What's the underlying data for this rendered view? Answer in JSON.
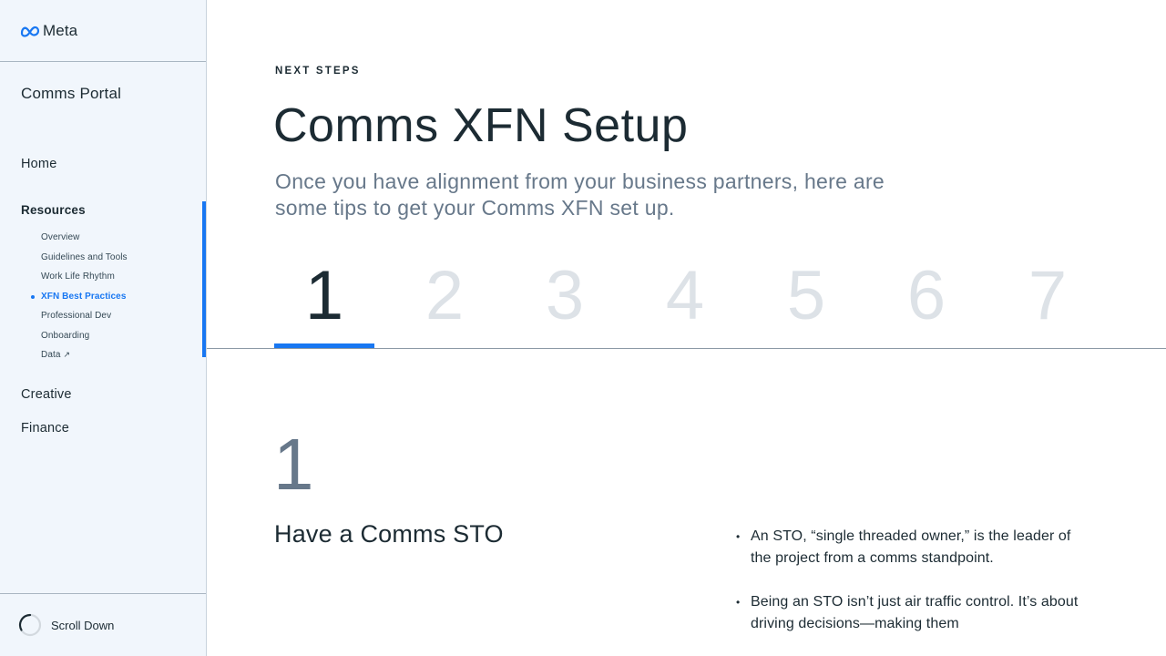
{
  "brand": {
    "name": "Meta"
  },
  "sidebar": {
    "portal_title": "Comms Portal",
    "nav": {
      "home": "Home",
      "resources": "Resources",
      "creative": "Creative",
      "finance": "Finance"
    },
    "resources_items": [
      {
        "label": "Overview"
      },
      {
        "label": "Guidelines and Tools"
      },
      {
        "label": "Work Life Rhythm"
      },
      {
        "label": "XFN Best Practices",
        "active": true
      },
      {
        "label": "Professional Dev"
      },
      {
        "label": "Onboarding"
      },
      {
        "label": "Data",
        "external_icon": "↗"
      }
    ],
    "scroll_label": "Scroll Down"
  },
  "main": {
    "eyebrow": "NEXT STEPS",
    "title": "Comms XFN Setup",
    "subtitle": "Once you have alignment from your business partners, here are some tips to get your Comms XFN set up.",
    "steps": [
      "1",
      "2",
      "3",
      "4",
      "5",
      "6",
      "7"
    ],
    "active_step": "1",
    "section": {
      "number": "1",
      "heading": "Have a Comms STO",
      "bullets": [
        "An STO, “single threaded owner,” is the leader of the project from a comms standpoint.",
        "Being an STO isn’t just air traffic control. It’s about driving decisions—making them"
      ]
    }
  },
  "colors": {
    "accent": "#1877f2",
    "sidebar_bg": "#f1f6fc",
    "text_primary": "#1c2b33",
    "text_muted": "#67788a",
    "step_inactive": "#dde2e7"
  }
}
